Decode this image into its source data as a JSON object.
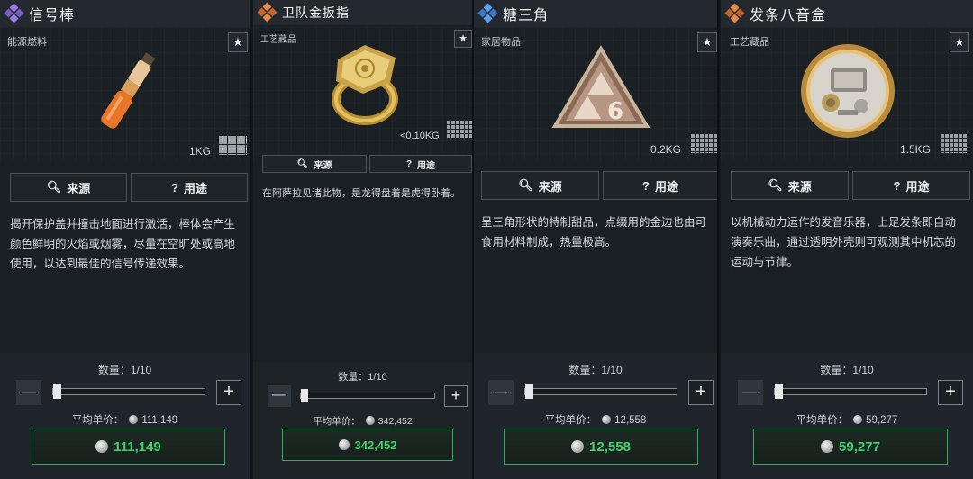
{
  "common": {
    "source_label": "来源",
    "use_label": "用途",
    "quantity_text": "数量：1/10",
    "avg_price_label": "平均单价：",
    "minus_glyph": "—",
    "plus_glyph": "+",
    "star_glyph": "★"
  },
  "cards": [
    {
      "title": "信号棒",
      "rarity_color": "#8a6bd6",
      "category": "能源燃料",
      "weight": "1KG",
      "description": "揭开保护盖并撞击地面进行激活，棒体会产生颜色鲜明的火焰或烟雾，尽量在空旷处或高地使用，以达到最佳的信号传递效果。",
      "avg_price": "111,149",
      "total_price": "111,149",
      "item_icon": "signal-flare-icon"
    },
    {
      "title": "卫队金扳指",
      "rarity_color": "#e07a3c",
      "category": "工艺藏品",
      "weight": "<0.10KG",
      "description": "在阿萨拉见诸此物，是龙得盘着是虎得卧着。",
      "avg_price": "342,452",
      "total_price": "342,452",
      "item_icon": "gold-ring-icon"
    },
    {
      "title": "糖三角",
      "rarity_color": "#4a8fe0",
      "category": "家居物品",
      "weight": "0.2KG",
      "description": "呈三角形状的特制甜品，点缀用的金边也由可食用材料制成，热量极高。",
      "avg_price": "12,558",
      "total_price": "12,558",
      "item_icon": "sugar-triangle-icon"
    },
    {
      "title": "发条八音盒",
      "rarity_color": "#e07a3c",
      "category": "工艺藏品",
      "weight": "1.5KG",
      "description": "以机械动力运作的发音乐器，上足发条即自动演奏乐曲，通过透明外壳则可观测其中机芯的运动与节律。",
      "avg_price": "59,277",
      "total_price": "59,277",
      "item_icon": "music-box-icon"
    }
  ]
}
